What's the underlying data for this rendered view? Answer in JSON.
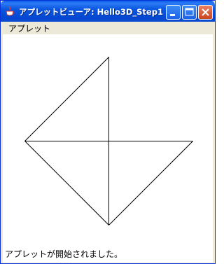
{
  "window": {
    "title": "アプレットビューア: Hello3D_Step1",
    "icon": "java-cup-icon",
    "controls": [
      "minimize-icon",
      "maximize-icon",
      "close-icon"
    ]
  },
  "menu": {
    "items": [
      "アプレット"
    ]
  },
  "status": {
    "text": "アプレットが開始されました。"
  },
  "colors": {
    "titlebar": "#0B58E0",
    "frame": "#ECE9D8",
    "canvas": "#FFFFFF",
    "lines": "#000000"
  }
}
